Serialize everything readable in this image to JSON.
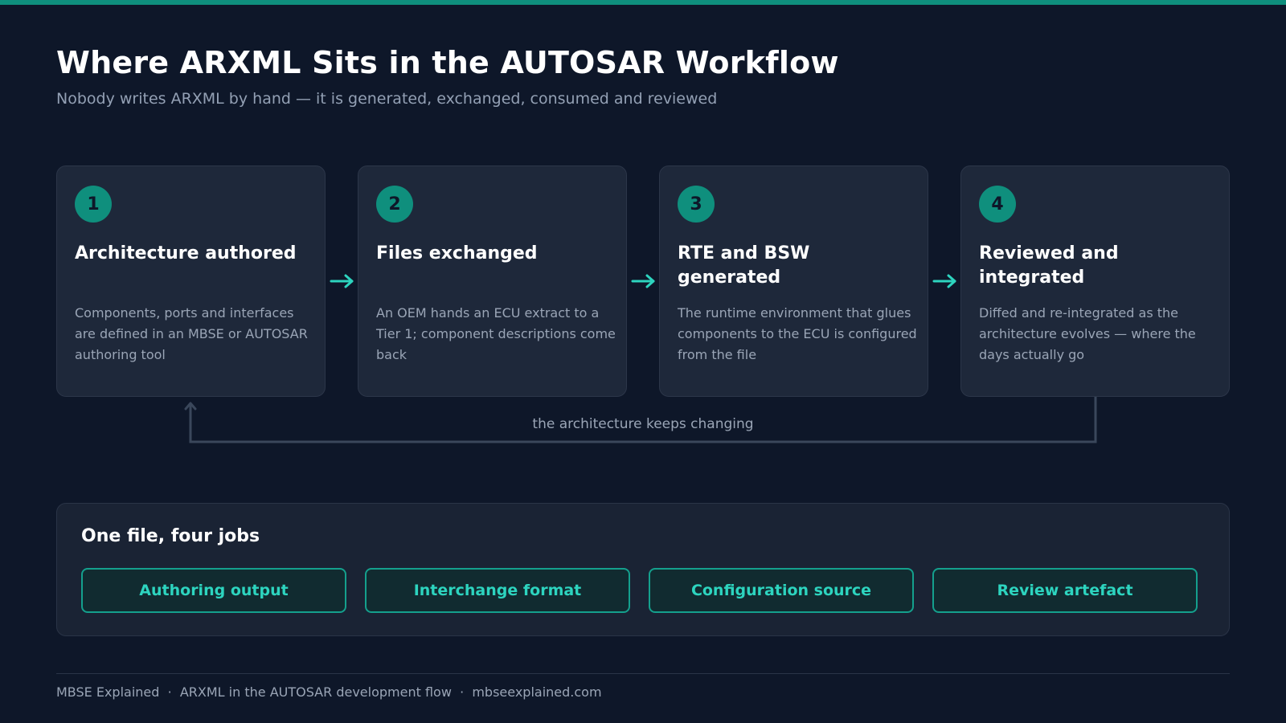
{
  "header": {
    "title": "Where ARXML Sits in the AUTOSAR Workflow",
    "subtitle": "Nobody writes ARXML by hand — it is generated, exchanged, consumed and reviewed"
  },
  "steps": [
    {
      "number": "1",
      "title": "Architecture authored",
      "description": "Components, ports and interfaces are defined in an MBSE or AUTOSAR authoring tool"
    },
    {
      "number": "2",
      "title": "Files exchanged",
      "description": "An OEM hands an ECU extract to a Tier 1; component descriptions come back"
    },
    {
      "number": "3",
      "title": "RTE and BSW generated",
      "description": "The runtime environment that glues components to the ECU is configured from the file"
    },
    {
      "number": "4",
      "title": "Reviewed and integrated",
      "description": "Diffed and re-integrated as the architecture evolves — where the days actually go"
    }
  ],
  "loop": {
    "label": "the architecture keeps changing"
  },
  "jobs": {
    "title": "One file, four jobs",
    "items": [
      "Authoring output",
      "Interchange format",
      "Configuration source",
      "Review artefact"
    ]
  },
  "footer": {
    "text": "MBSE Explained  ·  ARXML in the AUTOSAR development flow  ·  mbseexplained.com"
  },
  "colors": {
    "background": "#0e1729",
    "accent": "#0f8f7d",
    "accent_text": "#2dd4bf",
    "card": "#1e283a",
    "muted_text": "#9aa5b6"
  }
}
